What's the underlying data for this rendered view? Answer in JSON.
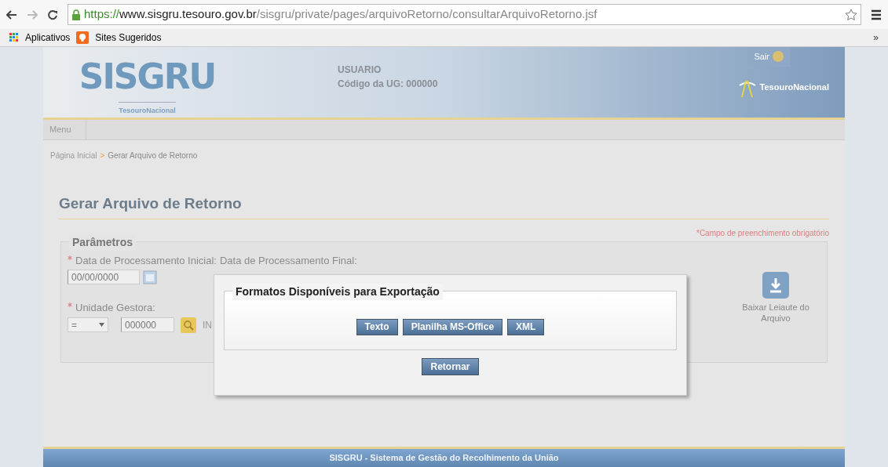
{
  "browser": {
    "url": {
      "scheme": "https://",
      "host": "www.sisgru.tesouro.gov.br",
      "path": "/sisgru/private/pages/arquivoRetorno/consultarArquivoRetorno.jsf"
    },
    "bookmarks": [
      "Aplicativos",
      "Sites Sugeridos"
    ],
    "overflow": "»"
  },
  "header": {
    "logo": "SISGRU",
    "logo_sub": "TesouroNacional",
    "user": "USUARIO",
    "ug": "Código da UG: 000000",
    "logout": "Sair",
    "brand": "TesouroNacional"
  },
  "menu": {
    "label": "Menu"
  },
  "breadcrumb": {
    "items": [
      "Página Inicial",
      "Gerar Arquivo de Retorno"
    ],
    "separator": ">"
  },
  "title": "Gerar Arquivo de Retorno",
  "required_note": "*Campo de preenchimento obrigatório",
  "parameters": {
    "legend": "Parâmetros",
    "labels": [
      {
        "text": "Data de Processamento Inicial:",
        "required": true
      },
      {
        "text": "Data de Processamento Final:",
        "required": false
      }
    ],
    "date_value": "00/00/0000",
    "unit_label": {
      "text": "Unidade Gestora:",
      "required": true
    },
    "operator": "=",
    "unit_code": "000000",
    "unit_name": "IN",
    "download": "Baixar Leiaute do Arquivo"
  },
  "modal": {
    "legend": "Formatos Disponíveis para Exportação",
    "formats": [
      "Texto",
      "Planilha MS-Office",
      "XML"
    ],
    "back": "Retornar"
  },
  "footer": "SISGRU - Sistema de Gestão do Recolhimento da União"
}
